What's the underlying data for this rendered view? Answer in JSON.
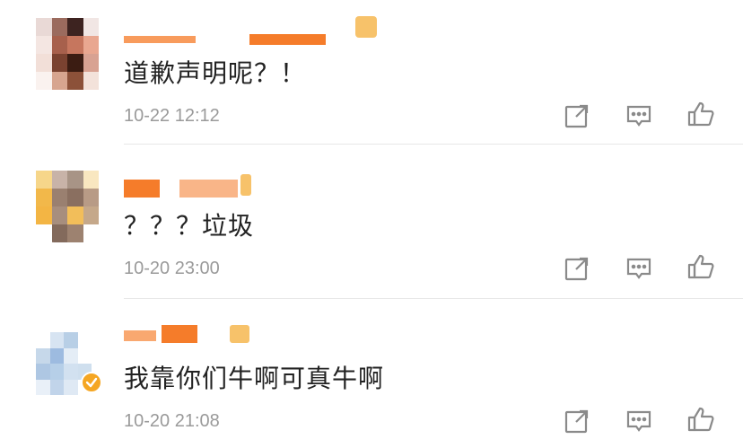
{
  "comments": [
    {
      "text": "道歉声明呢？！",
      "time": "10-22 12:12",
      "avatar_icon": "pixelated-avatar",
      "actions": [
        "share-icon",
        "comment-icon",
        "like-icon"
      ]
    },
    {
      "text": "？？？垃圾",
      "time": "10-20 23:00",
      "avatar_icon": "pixelated-avatar",
      "actions": [
        "share-icon",
        "comment-icon",
        "like-icon"
      ]
    },
    {
      "text": "我靠你们牛啊可真牛啊",
      "time": "10-20 21:08",
      "avatar_icon": "pixelated-avatar",
      "verified_badge": "verified-v-icon",
      "actions": [
        "share-icon",
        "comment-icon",
        "like-icon"
      ]
    }
  ],
  "colors": {
    "username_redacted": "#f57c2a",
    "timestamp": "#9a9a9a",
    "icon": "#8a8a8a",
    "verified_badge": "#f5a623"
  }
}
